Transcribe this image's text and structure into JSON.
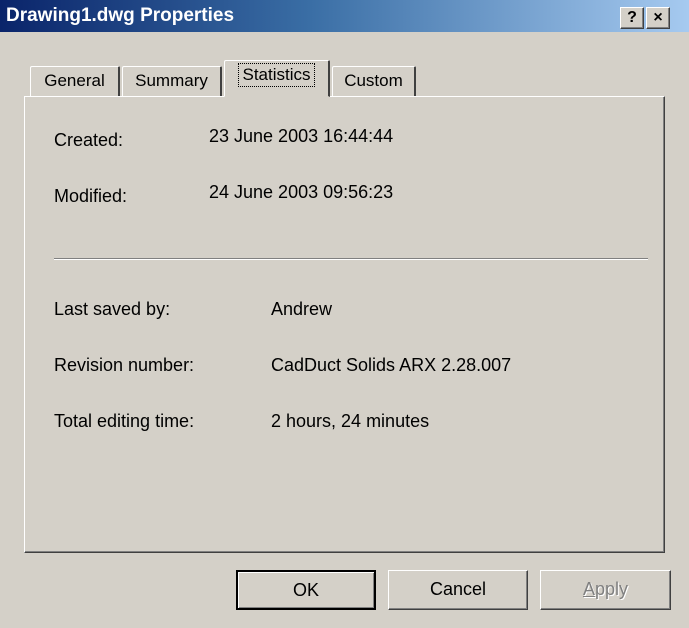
{
  "window": {
    "title": "Drawing1.dwg Properties",
    "help_label": "?",
    "close_label": "×"
  },
  "tabs": [
    {
      "label": "General",
      "active": false
    },
    {
      "label": "Summary",
      "active": false
    },
    {
      "label": "Statistics",
      "active": true
    },
    {
      "label": "Custom",
      "active": false
    }
  ],
  "statistics": {
    "created_label": "Created:",
    "created_value": "23 June 2003  16:44:44",
    "modified_label": "Modified:",
    "modified_value": "24 June 2003  09:56:23",
    "last_saved_by_label": "Last saved by:",
    "last_saved_by_value": "Andrew",
    "revision_number_label": "Revision number:",
    "revision_number_value": "CadDuct Solids ARX 2.28.007",
    "total_editing_time_label": "Total editing time:",
    "total_editing_time_value": "2 hours, 24 minutes"
  },
  "buttons": {
    "ok": "OK",
    "cancel": "Cancel",
    "apply_first": "A",
    "apply_rest": "pply"
  }
}
